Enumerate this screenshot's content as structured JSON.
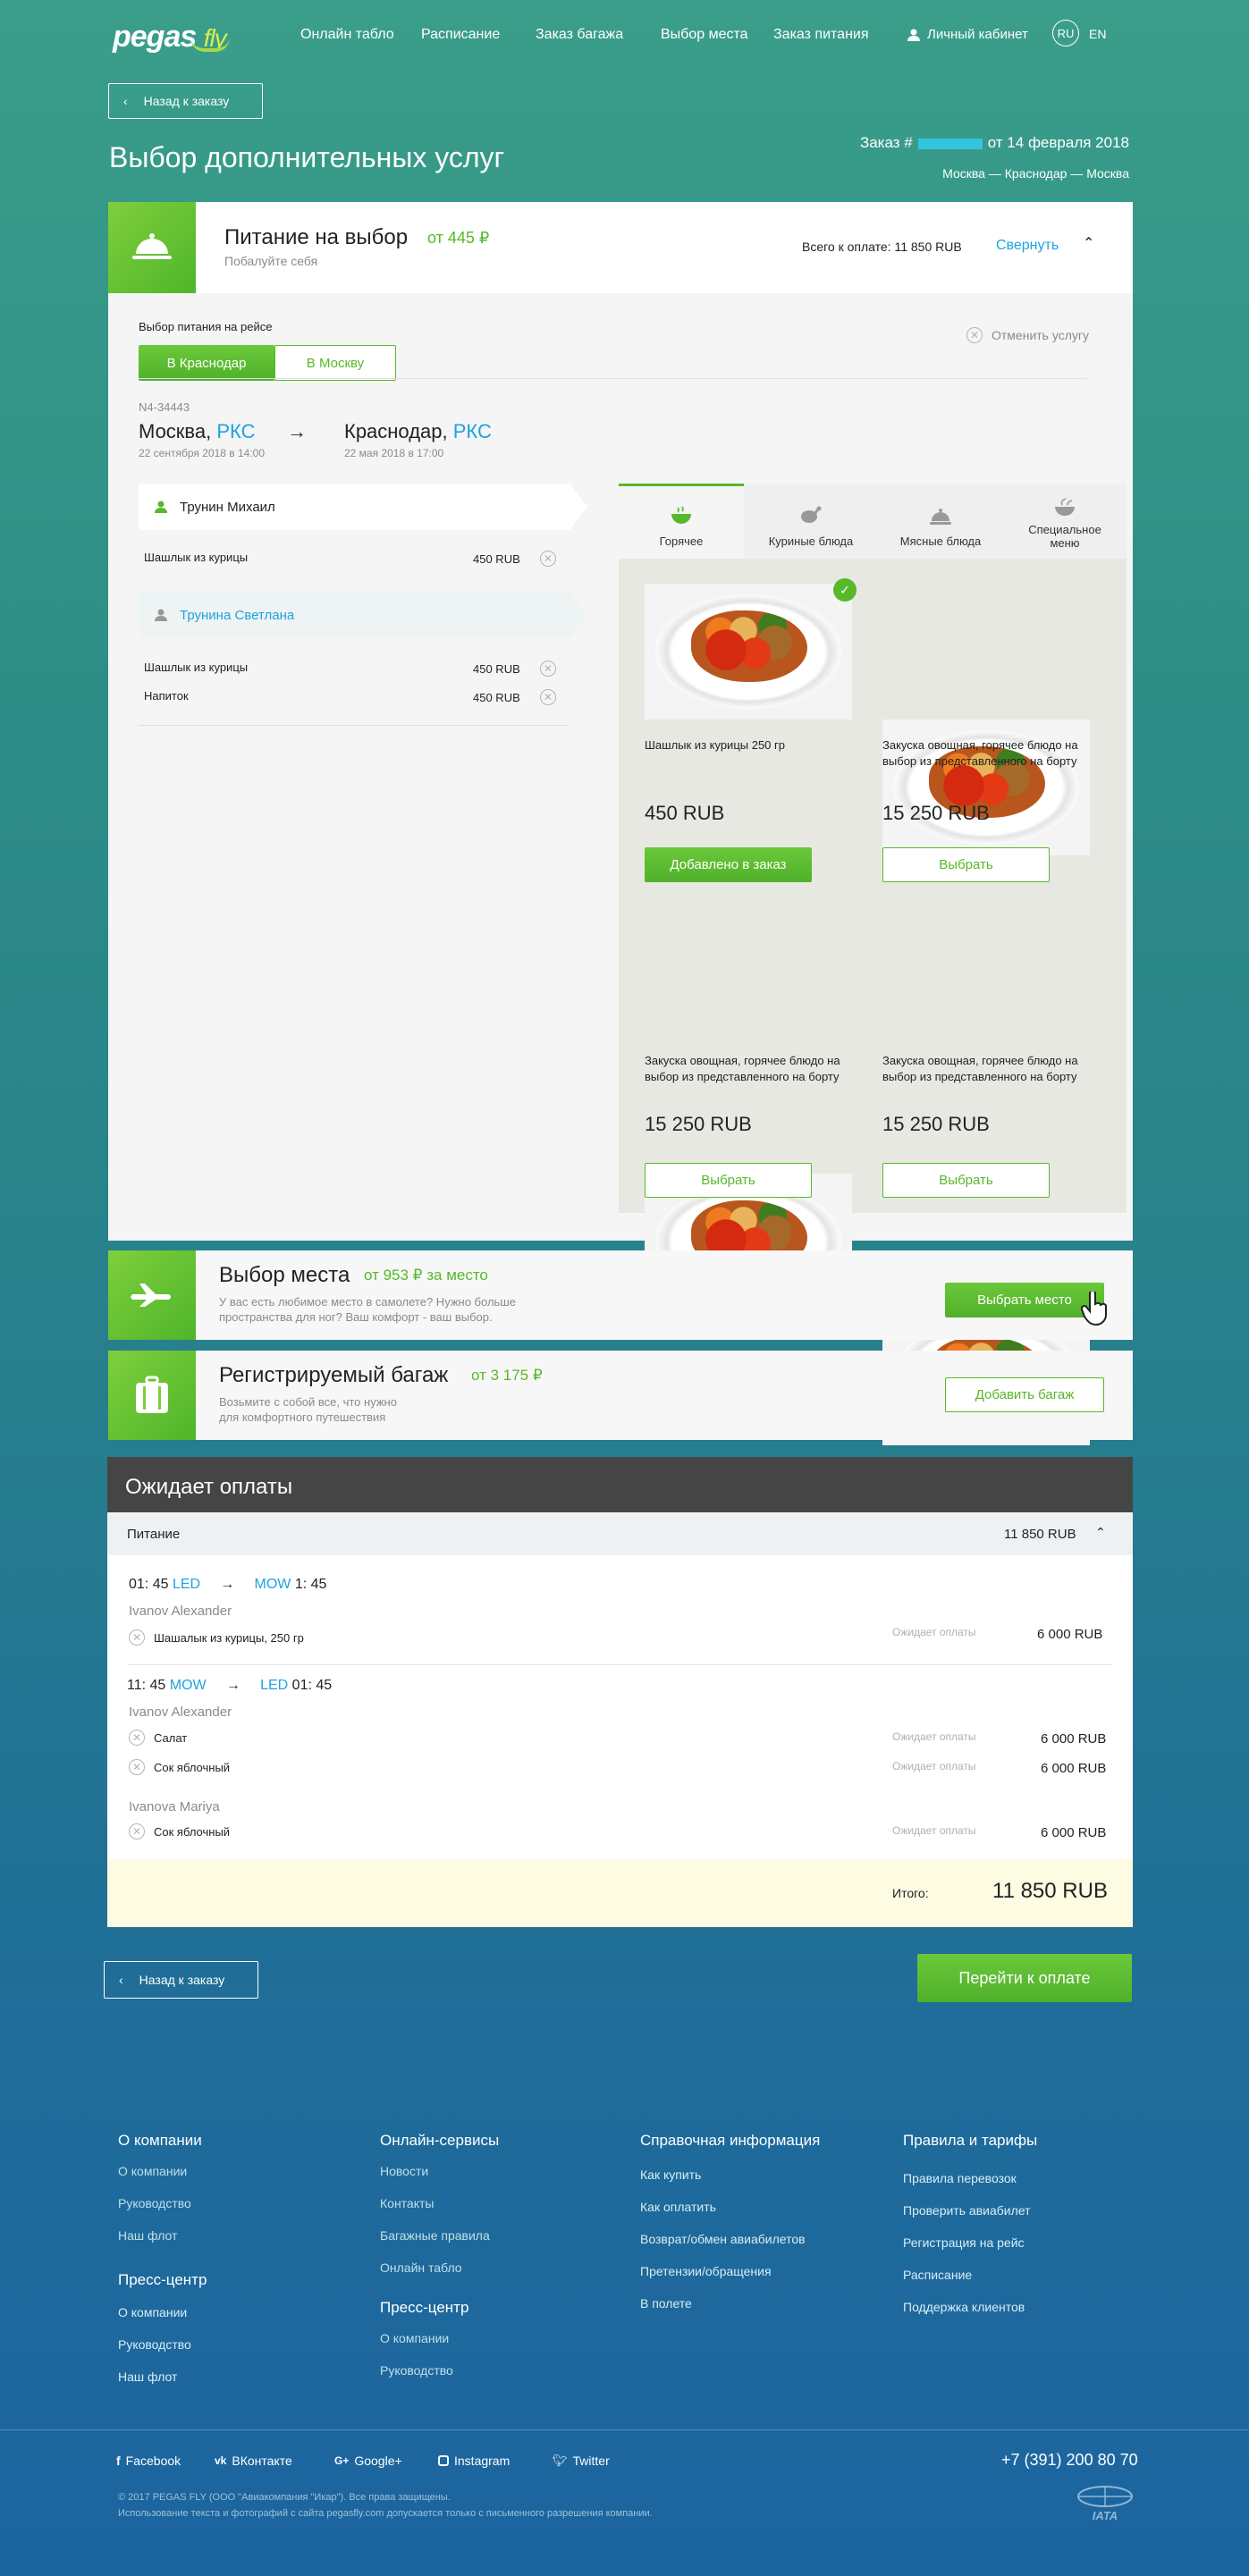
{
  "header": {
    "logo_main": "pegas",
    "logo_sub": "fly",
    "nav": [
      "Онлайн табло",
      "Расписание",
      "Заказ багажа",
      "Выбор места",
      "Заказ питания"
    ],
    "cabinet": "Личный кабинет",
    "lang_ru": "RU",
    "lang_en": "EN"
  },
  "back_label": "Назад к заказу",
  "page_title": "Выбор дополнительных услуг",
  "order": {
    "prefix": "Заказ #",
    "date": "от 14 февраля 2018",
    "route": "Москва — Краснодар —  Москва"
  },
  "meal": {
    "title": "Питание на выбор",
    "price": "от 445 ₽",
    "subtitle": "Побалуйте себя",
    "total": "Всего к оплате: 11 850 RUB",
    "collapse": "Свернуть",
    "select_label": "Выбор питания на рейсе",
    "dir_tabs": [
      "В Краснодар",
      "В Москву"
    ],
    "cancel": "Отменить услугу",
    "flight_no": "N4-34443",
    "from_city": "Москва, ",
    "from_code": "РКС",
    "from_date": "22 сентября 2018 в 14:00",
    "arrow": "→",
    "to_city": "Краснодар, ",
    "to_code": "РКС",
    "to_date": "22 мая 2018 в 17:00",
    "passengers": [
      {
        "name": "Трунин Михаил",
        "items": [
          {
            "name": "Шашлык из курицы",
            "price": "450 RUB"
          }
        ]
      },
      {
        "name": "Трунина Светлана",
        "items": [
          {
            "name": "Шашлык из курицы",
            "price": "450 RUB"
          },
          {
            "name": "Напиток",
            "price": "450 RUB"
          }
        ]
      }
    ],
    "cat_tabs": [
      "Горячее",
      "Куриные блюда",
      "Мясные блюда",
      "Специальное меню"
    ],
    "cards": [
      {
        "desc": "Шашлык из курицы 250 гр",
        "price": "450 RUB",
        "btn": "Добавлено в заказ"
      },
      {
        "desc": "Закуска овощная, горячее блюдо на выбор из представленного на борту",
        "price": "15 250 RUB",
        "btn": "Выбрать"
      },
      {
        "desc": "Закуска овощная, горячее блюдо на выбор из представленного на борту",
        "price": "15 250 RUB",
        "btn": "Выбрать"
      },
      {
        "desc": "Закуска овощная, горячее блюдо на выбор из представленного на борту",
        "price": "15 250 RUB",
        "btn": "Выбрать"
      }
    ]
  },
  "seat": {
    "title": "Выбор места",
    "price": "от 953 ₽ за место",
    "desc1": "У вас есть любимое место в самолете? Нужно больше",
    "desc2": "пространства для ног? Ваш комфорт - ваш выбор.",
    "btn": "Выбрать место"
  },
  "baggage": {
    "title": "Регистрируемый багаж",
    "price": "от 3 175 ₽",
    "desc1": "Возьмите с собой все, что нужно",
    "desc2": "для комфортного путешествия",
    "btn": "Добавить багаж"
  },
  "payment": {
    "title": "Ожидает оплаты",
    "section": "Питание",
    "section_total": "11 850 RUB",
    "seg1": {
      "dep": "01: 45",
      "from": "LED",
      "arrow": "→",
      "to": "MOW",
      "arr": "1: 45",
      "pax": "Ivanov Alexander",
      "item": "Шашалык из курицы, 250 гр",
      "status": "Ожидает оплаты",
      "price": "6 000  RUB"
    },
    "seg2": {
      "dep": "11: 45",
      "from": "MOW",
      "arrow": "→",
      "to": "LED",
      "arr": "01: 45",
      "pax": "Ivanov Alexander",
      "items": [
        {
          "name": "Салат",
          "status": "Ожидает оплаты",
          "price": "6 000 RUB"
        },
        {
          "name": "Сок яблочный",
          "status": "Ожидает оплаты",
          "price": "6 000 RUB"
        }
      ],
      "pax2": "Ivanova Mariya",
      "item2": {
        "name": "Сок яблочный",
        "status": "Ожидает оплаты",
        "price": "6 000 RUB"
      }
    },
    "total_label": "Итого:",
    "total": "11 850 RUB"
  },
  "pay_btn": "Перейти к оплате",
  "footer": {
    "cols": [
      {
        "h": "О компании",
        "items": [
          "О компании",
          "Руководство",
          "Наш флот"
        ],
        "h2": "Пресс-центр",
        "items2": [
          "О компании",
          "Руководство",
          "Наш флот"
        ]
      },
      {
        "h": "Онлайн-сервисы",
        "items": [
          "Новости",
          "Контакты",
          "Багажные правила",
          "Онлайн табло"
        ],
        "h2": "Пресс-центр",
        "items2": [
          "О компании",
          "Руководство"
        ]
      },
      {
        "h": "Справочная информация",
        "items": [
          "Как купить",
          "Как оплатить",
          "Возврат/обмен авиабилетов",
          "Претензии/обращения",
          "В полете"
        ]
      },
      {
        "h": "Правила и тарифы",
        "items": [
          "Правила перевозок",
          "Проверить авиабилет",
          "Регистрация на рейс",
          "Расписание",
          "Поддержка клиентов"
        ]
      }
    ],
    "social": [
      "Facebook",
      "ВКонтакте",
      "Google+",
      "Instagram",
      "Twitter"
    ],
    "phone": "+7 (391) 200 80 70",
    "copy1": "© 2017 PEGAS FLY (ООО \"Авиакомпания \"Икар\"). Все права защищены.",
    "copy2": "Использование текста и фотографий с сайта pegasfly.com допускается только с письменного разрешения компании.",
    "iata": "IATA"
  }
}
